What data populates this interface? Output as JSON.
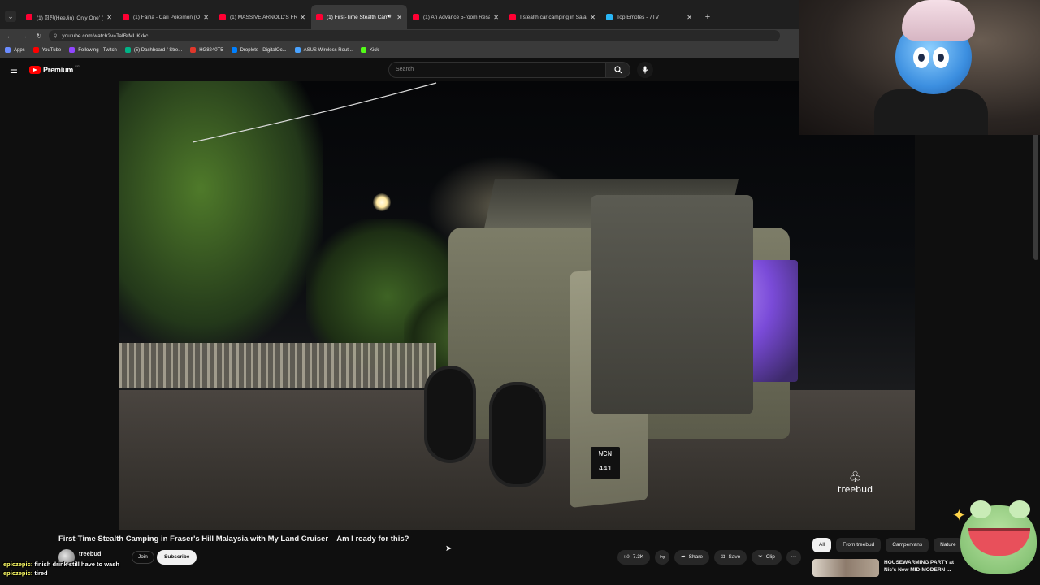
{
  "browser": {
    "tabs": [
      {
        "title": "(1) 희진(HeeJin) 'Only One' (Bo",
        "active": false
      },
      {
        "title": "(1) Faiha - Cari Pokemon (Offic",
        "active": false
      },
      {
        "title": "(1) MASSIVE ARNOLD'S FRIED",
        "active": false
      },
      {
        "title": "(1) First-Time Stealth Camp",
        "active": true
      },
      {
        "title": "(1) An Advance 5-room Resale",
        "active": false
      },
      {
        "title": "I stealth car camping in Salak S",
        "active": false
      },
      {
        "title": "Top Emotes - 7TV",
        "active": false
      }
    ],
    "url": "youtube.com/watch?v=TaIBrMUKkkc",
    "bookmarks": [
      {
        "label": "Apps",
        "color": "#6b8cff"
      },
      {
        "label": "YouTube",
        "color": "#ff0000"
      },
      {
        "label": "Following - Twitch",
        "color": "#9146ff"
      },
      {
        "label": "(5) Dashboard / Stre...",
        "color": "#00b386"
      },
      {
        "label": "HG8240T5",
        "color": "#e0372b"
      },
      {
        "label": "Droplets - DigitalOc...",
        "color": "#0080ff"
      },
      {
        "label": "ASUS Wireless Rout...",
        "color": "#4aa3ff"
      },
      {
        "label": "Kick",
        "color": "#53fc18"
      }
    ]
  },
  "youtube": {
    "logo_text": "Premium",
    "search_placeholder": "Search"
  },
  "video": {
    "title": "First-Time Stealth Camping in Fraser's Hill Malaysia with My Land Cruiser – Am I ready for this?",
    "channel": "treebud",
    "watermark": "treebud",
    "plate": "WCN 441",
    "join_label": "Join",
    "subscribe_label": "Subscribe",
    "likes": "7.3K",
    "share_label": "Share",
    "save_label": "Save",
    "clip_label": "Clip"
  },
  "chips": [
    "All",
    "From treebud",
    "Campervans",
    "Nature"
  ],
  "related": {
    "title_line1": "HOUSEWARMING PARTY at",
    "title_line2": "Nic's New MID-MODERN ..."
  },
  "chat": [
    {
      "user": "epiczepic:",
      "message": "finish drink still have to wash"
    },
    {
      "user": "epiczepic:",
      "message": "tired"
    }
  ],
  "colors": {
    "youtube_red": "#ff0000",
    "background": "#0f0f0f",
    "chat_username": "#ffff66"
  }
}
